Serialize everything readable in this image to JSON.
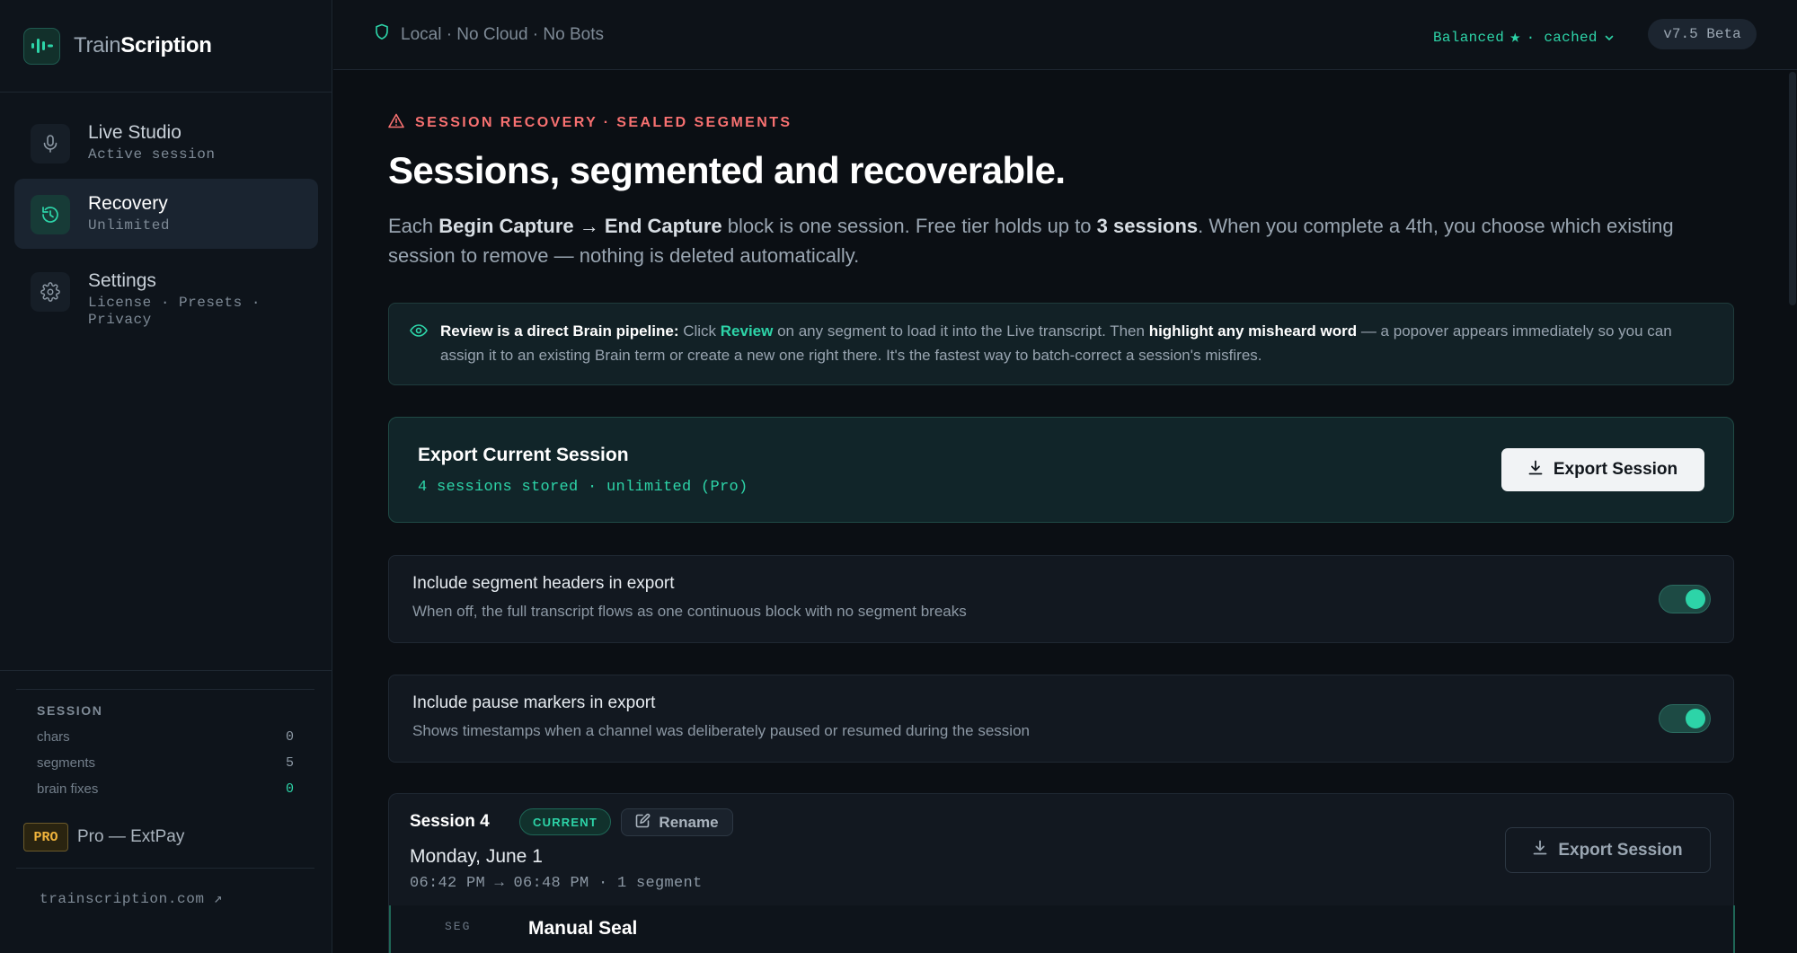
{
  "brand": {
    "name_light": "Train",
    "name_bold": "Scription"
  },
  "nav": [
    {
      "title": "Live Studio",
      "sub": "Active session"
    },
    {
      "title": "Recovery",
      "sub": "Unlimited"
    },
    {
      "title": "Settings",
      "sub": "License · Presets · Privacy"
    }
  ],
  "session_stats": {
    "label": "SESSION",
    "rows": [
      {
        "key": "chars",
        "value": "0"
      },
      {
        "key": "segments",
        "value": "5"
      },
      {
        "key": "brain fixes",
        "value": "0"
      }
    ]
  },
  "plan": {
    "badge": "PRO",
    "text": "Pro — ExtPay"
  },
  "site_link": "trainscription.com ↗",
  "topbar": {
    "privacy": "Local · No Cloud · No Bots",
    "mode": "Balanced",
    "mode_suffix": "· cached",
    "version": "v7.5 Beta"
  },
  "page": {
    "eyebrow": "SESSION RECOVERY · SEALED SEGMENTS",
    "title": "Sessions, segmented and recoverable.",
    "lead": {
      "p1": "Each ",
      "b1": "Begin Capture → End Capture",
      "p2": " block is one session. Free tier holds up to ",
      "b2": "3 sessions",
      "p3": ". When you complete a 4th, you choose which existing session to remove — nothing is deleted automatically."
    },
    "info": {
      "b1": "Review is a direct Brain pipeline:",
      "p1": " Click ",
      "link": "Review",
      "p2": " on any segment to load it into the Live transcript. Then ",
      "b2": "highlight any misheard word",
      "p3": " — a popover appears immediately so you can assign it to an existing Brain term or create a new one right there. It's the fastest way to batch-correct a session's misfires."
    },
    "export": {
      "title": "Export Current Session",
      "sub": "4 sessions stored · unlimited (Pro)",
      "button": "Export Session"
    },
    "toggles": [
      {
        "title": "Include segment headers in export",
        "sub": "When off, the full transcript flows as one continuous block with no segment breaks",
        "on": true
      },
      {
        "title": "Include pause markers in export",
        "sub": "Shows timestamps when a channel was deliberately paused or resumed during the session",
        "on": true
      }
    ],
    "session": {
      "title": "Session 4",
      "badge": "CURRENT",
      "rename": "Rename",
      "date": "Monday, June 1",
      "time": "06:42 PM → 06:48 PM · 1 segment",
      "export": "Export Session",
      "segment_label": "SEG",
      "segment_title": "Manual Seal"
    }
  },
  "colors": {
    "accent": "#2dd4a8",
    "warning": "#f87171",
    "pro": "#f0b43c"
  }
}
